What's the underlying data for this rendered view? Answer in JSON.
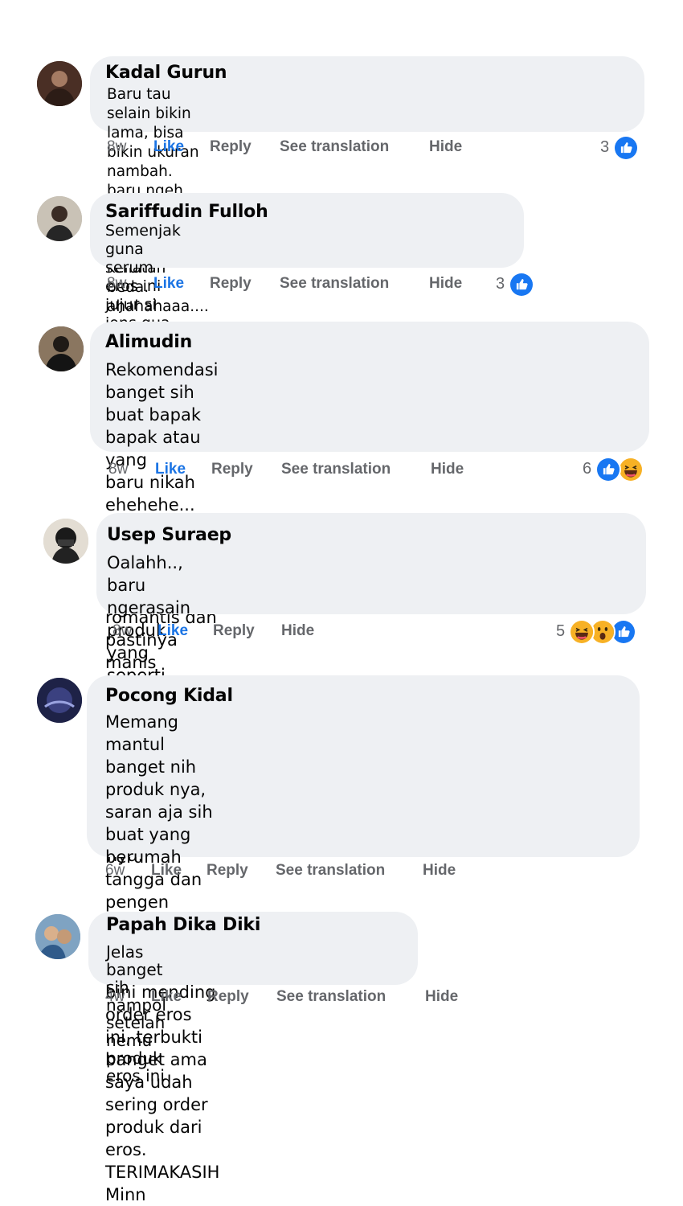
{
  "comments": [
    {
      "name": "Kadal Gurun",
      "text": "Baru tau selain bikin lama, bisa bikin ukuran nambah. baru ngeh\npas rutin pakai. istri sampe bilang keliatan beda. ahahahaaa....",
      "time": "8w",
      "like": "Like",
      "reply": "Reply",
      "translate": "See translation",
      "hide": "Hide",
      "reaction_count": "3",
      "reactions": [
        "like-icon"
      ]
    },
    {
      "name": "Sariffudin Fulloh",
      "text": "Semenjak guna serum eros ini jujur si jons gua\njadi gede sih sesuai banget sama iklan",
      "time": "8w",
      "like": "Like",
      "reply": "Reply",
      "translate": "See translation",
      "hide": "Hide",
      "reaction_count": "3",
      "reactions": [
        "like-icon"
      ]
    },
    {
      "name": "Alimudin",
      "text": "Rekomendasi banget sih buat bapak bapak atau yang\nbaru nikah ehehehe... Udah pasti terjamin bikin\nhubungan romantis dan pastinya manis",
      "time": "8w",
      "like": "Like",
      "reply": "Reply",
      "translate": "See translation",
      "hide": "Hide",
      "reaction_count": "6",
      "reactions": [
        "like-icon",
        "haha-icon"
      ]
    },
    {
      "name": "Usep Suraep",
      "text": "Oalahh.., baru ngerasain produk yang seperti ini. gak\nnyangka bakal se-manjur ini buat saya serum nya.",
      "time": "8w",
      "like": "Like",
      "reply": "Reply",
      "hide": "Hide",
      "reaction_count": "5",
      "reactions": [
        "haha-icon",
        "wow-icon",
        "like-icon"
      ]
    },
    {
      "name": "Pocong Kidal",
      "text": "Memang mantul banget nih produk nya, saran aja sih\nbuat yang berumah tangga dan pengen gaspol\ngaspolan terus ama bini mending order eros ini, terbukti\nbanget ama saya udah sering order produk dari eros.\nTERIMAKASIH Minn",
      "time": "6w",
      "like": "Like",
      "reply": "Reply",
      "translate": "See translation",
      "hide": "Hide"
    },
    {
      "name": "Papah Dika Diki",
      "text": "Jelas banget sih nampol\nsetelah nemu produk eros ini",
      "time": "4w",
      "like": "Like",
      "reply": "Reply",
      "translate": "See translation",
      "hide": "Hide"
    }
  ],
  "colors": {
    "bubble": "#eef0f3",
    "like_active": "#1b74e4",
    "meta": "#65676b",
    "reaction_like": "#1877f2",
    "reaction_haha": "#f7b125"
  }
}
